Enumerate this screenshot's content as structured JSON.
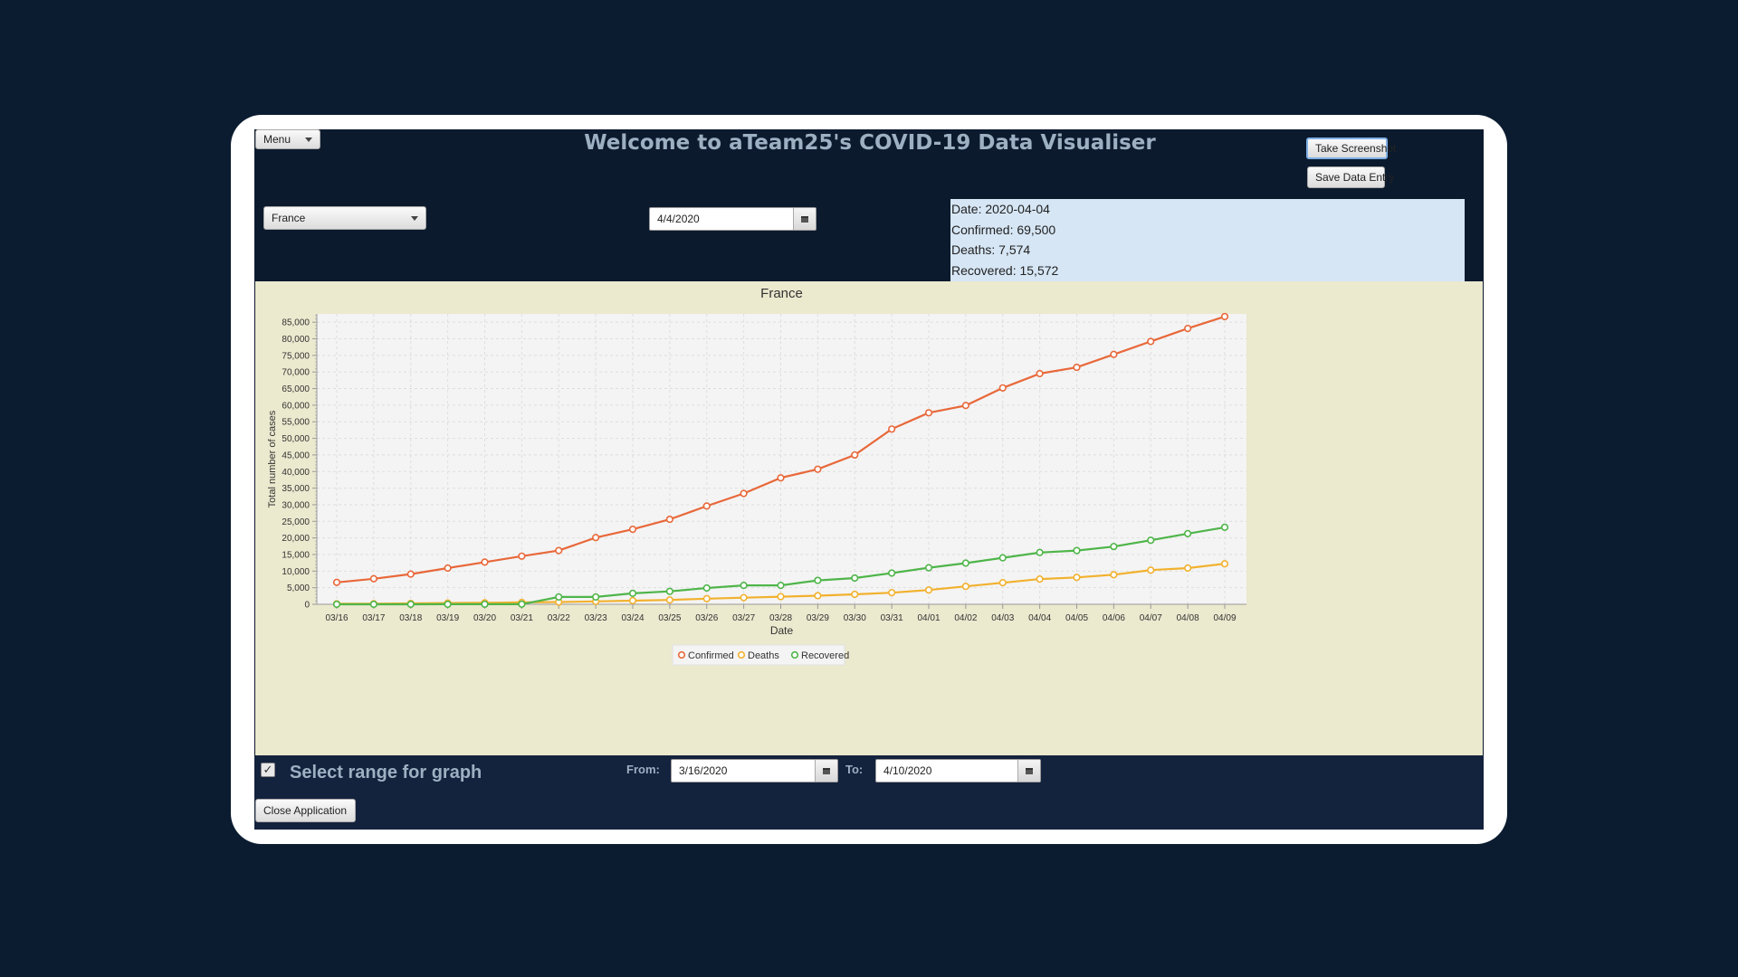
{
  "menu": {
    "label": "Menu"
  },
  "header": {
    "title": "Welcome to aTeam25's COVID-19 Data Visualiser"
  },
  "toolbar": {
    "screenshot_label": "Take Screenshot",
    "save_label": "Save Data Entry"
  },
  "country_select": {
    "value": "France"
  },
  "date_picker": {
    "value": "4/4/2020"
  },
  "info_panel": {
    "date": "Date: 2020-04-04",
    "confirmed": "Confirmed: 69,500",
    "deaths": "Deaths: 7,574",
    "recovered": "Recovered: 15,572"
  },
  "range": {
    "checked": true,
    "label": "Select range for graph",
    "from_label": "From:",
    "from_value": "3/16/2020",
    "to_label": "To:",
    "to_value": "4/10/2020"
  },
  "close_button": {
    "label": "Close Application"
  },
  "colors": {
    "confirmed": "#e8683a",
    "deaths": "#f2b12e",
    "recovered": "#4fb54a"
  },
  "chart_data": {
    "type": "line",
    "title": "France",
    "xlabel": "Date",
    "ylabel": "Total number of cases",
    "categories": [
      "03/16",
      "03/17",
      "03/18",
      "03/19",
      "03/20",
      "03/21",
      "03/22",
      "03/23",
      "03/24",
      "03/25",
      "03/26",
      "03/27",
      "03/28",
      "03/29",
      "03/30",
      "03/31",
      "04/01",
      "04/02",
      "04/03",
      "04/04",
      "04/05",
      "04/06",
      "04/07",
      "04/08",
      "04/09"
    ],
    "ylim": [
      0,
      87500
    ],
    "yticks": [
      0,
      5000,
      10000,
      15000,
      20000,
      25000,
      30000,
      35000,
      40000,
      45000,
      50000,
      55000,
      60000,
      65000,
      70000,
      75000,
      80000,
      85000
    ],
    "ytick_labels": [
      "0",
      "5,000",
      "10,000",
      "15,000",
      "20,000",
      "25,000",
      "30,000",
      "35,000",
      "40,000",
      "45,000",
      "50,000",
      "55,000",
      "60,000",
      "65,000",
      "70,000",
      "75,000",
      "80,000",
      "85,000"
    ],
    "grid": true,
    "legend": "bottom",
    "series": [
      {
        "name": "Confirmed",
        "values": [
          6600,
          7700,
          9100,
          10900,
          12700,
          14500,
          16200,
          20100,
          22600,
          25600,
          29600,
          33400,
          38100,
          40700,
          45000,
          52800,
          57700,
          59900,
          65200,
          69500,
          71400,
          75300,
          79200,
          83100,
          86700
        ]
      },
      {
        "name": "Deaths",
        "values": [
          150,
          170,
          260,
          370,
          450,
          560,
          670,
          860,
          1100,
          1300,
          1700,
          2000,
          2300,
          2600,
          3000,
          3500,
          4300,
          5400,
          6500,
          7600,
          8100,
          8900,
          10300,
          10900,
          12200
        ]
      },
      {
        "name": "Recovered",
        "values": [
          10,
          10,
          10,
          15,
          20,
          30,
          2200,
          2200,
          3300,
          3900,
          4900,
          5700,
          5700,
          7200,
          7900,
          9400,
          11000,
          12400,
          14000,
          15600,
          16200,
          17400,
          19300,
          21300,
          23200
        ]
      }
    ]
  }
}
